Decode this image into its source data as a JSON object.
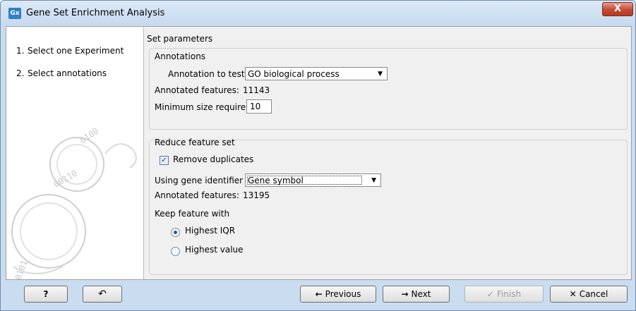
{
  "window": {
    "title": "Gene Set Enrichment Analysis",
    "app_icon": "Gx",
    "close": "X"
  },
  "steps": [
    {
      "num": "1.",
      "label": "Select one Experiment"
    },
    {
      "num": "2.",
      "label": "Select annotations"
    }
  ],
  "panel_title": "Set parameters",
  "annotations": {
    "legend": "Annotations",
    "annotation_label": "Annotation to test",
    "annotation_value": "GO biological process",
    "annotated_label": "Annotated features:",
    "annotated_value": "11143",
    "min_size_label": "Minimum size required",
    "min_size_value": "10"
  },
  "reduce": {
    "legend": "Reduce feature set",
    "remove_duplicates": "Remove duplicates",
    "remove_duplicates_checked": true,
    "identifier_label": "Using gene identifier",
    "identifier_value": "Gene symbol",
    "annotated_label": "Annotated features:",
    "annotated_value": "13195",
    "keep_label": "Keep feature with",
    "options": [
      "Highest IQR",
      "Highest value"
    ],
    "selected": "Highest IQR"
  },
  "buttons": {
    "help": "?",
    "reset_icon": "reset-icon",
    "previous": "Previous",
    "next": "Next",
    "finish": "Finish",
    "cancel": "Cancel"
  }
}
